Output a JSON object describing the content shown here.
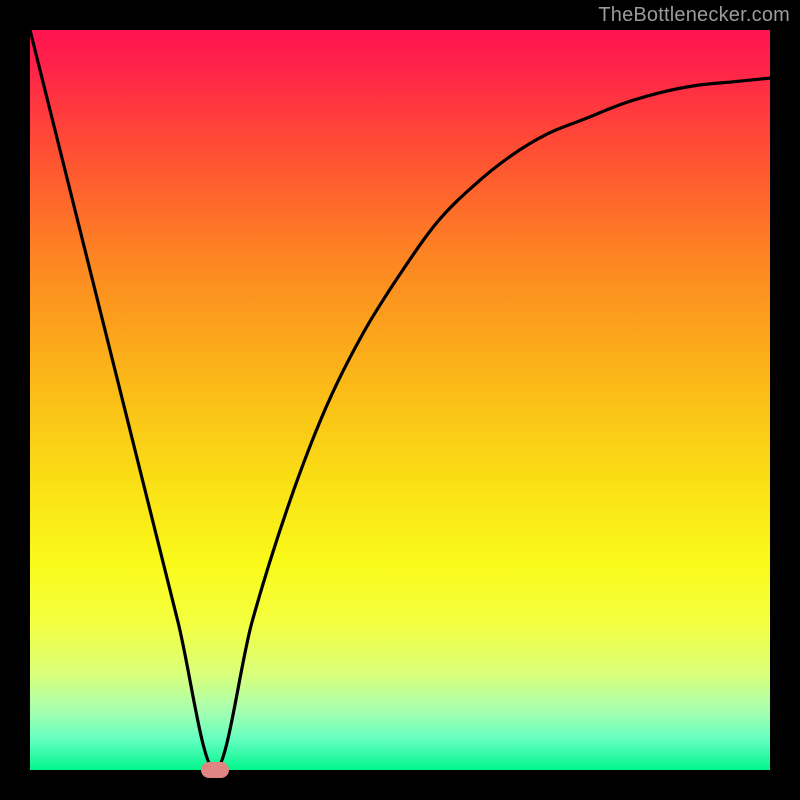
{
  "domain": "Chart",
  "watermark": "TheBottlenecker.com",
  "colors": {
    "background": "#000000",
    "frame": "#000000",
    "watermark_text": "#9b9b9b",
    "marker_fill": "#E08682",
    "curve_stroke": "#000000",
    "gradient_stops": [
      {
        "offset": 0.0,
        "color": "#FF1452"
      },
      {
        "offset": 0.05,
        "color": "#FF2349"
      },
      {
        "offset": 0.15,
        "color": "#FF4A36"
      },
      {
        "offset": 0.3,
        "color": "#FD8223"
      },
      {
        "offset": 0.45,
        "color": "#FBB119"
      },
      {
        "offset": 0.6,
        "color": "#FADC15"
      },
      {
        "offset": 0.72,
        "color": "#FAFA1A"
      },
      {
        "offset": 0.8,
        "color": "#F4FF3F"
      },
      {
        "offset": 0.87,
        "color": "#DAFF7A"
      },
      {
        "offset": 0.92,
        "color": "#A6FFB0"
      },
      {
        "offset": 0.96,
        "color": "#62FFC0"
      },
      {
        "offset": 1.0,
        "color": "#00F58B"
      }
    ]
  },
  "chart_data": {
    "type": "line",
    "title": "",
    "xlabel": "",
    "ylabel": "",
    "xlim": [
      0,
      100
    ],
    "ylim": [
      0,
      100
    ],
    "annotations": [
      {
        "name": "optimum-marker",
        "x": 25,
        "y": 0
      }
    ],
    "series": [
      {
        "name": "bottleneck-curve",
        "x": [
          0,
          5,
          10,
          15,
          20,
          25,
          30,
          35,
          40,
          45,
          50,
          55,
          60,
          65,
          70,
          75,
          80,
          85,
          90,
          95,
          100
        ],
        "y_pct": [
          100,
          80,
          60,
          40,
          20,
          0,
          20,
          36,
          49,
          59,
          67,
          74,
          79,
          83,
          86,
          88,
          90,
          91.5,
          92.5,
          93,
          93.5
        ]
      }
    ]
  }
}
